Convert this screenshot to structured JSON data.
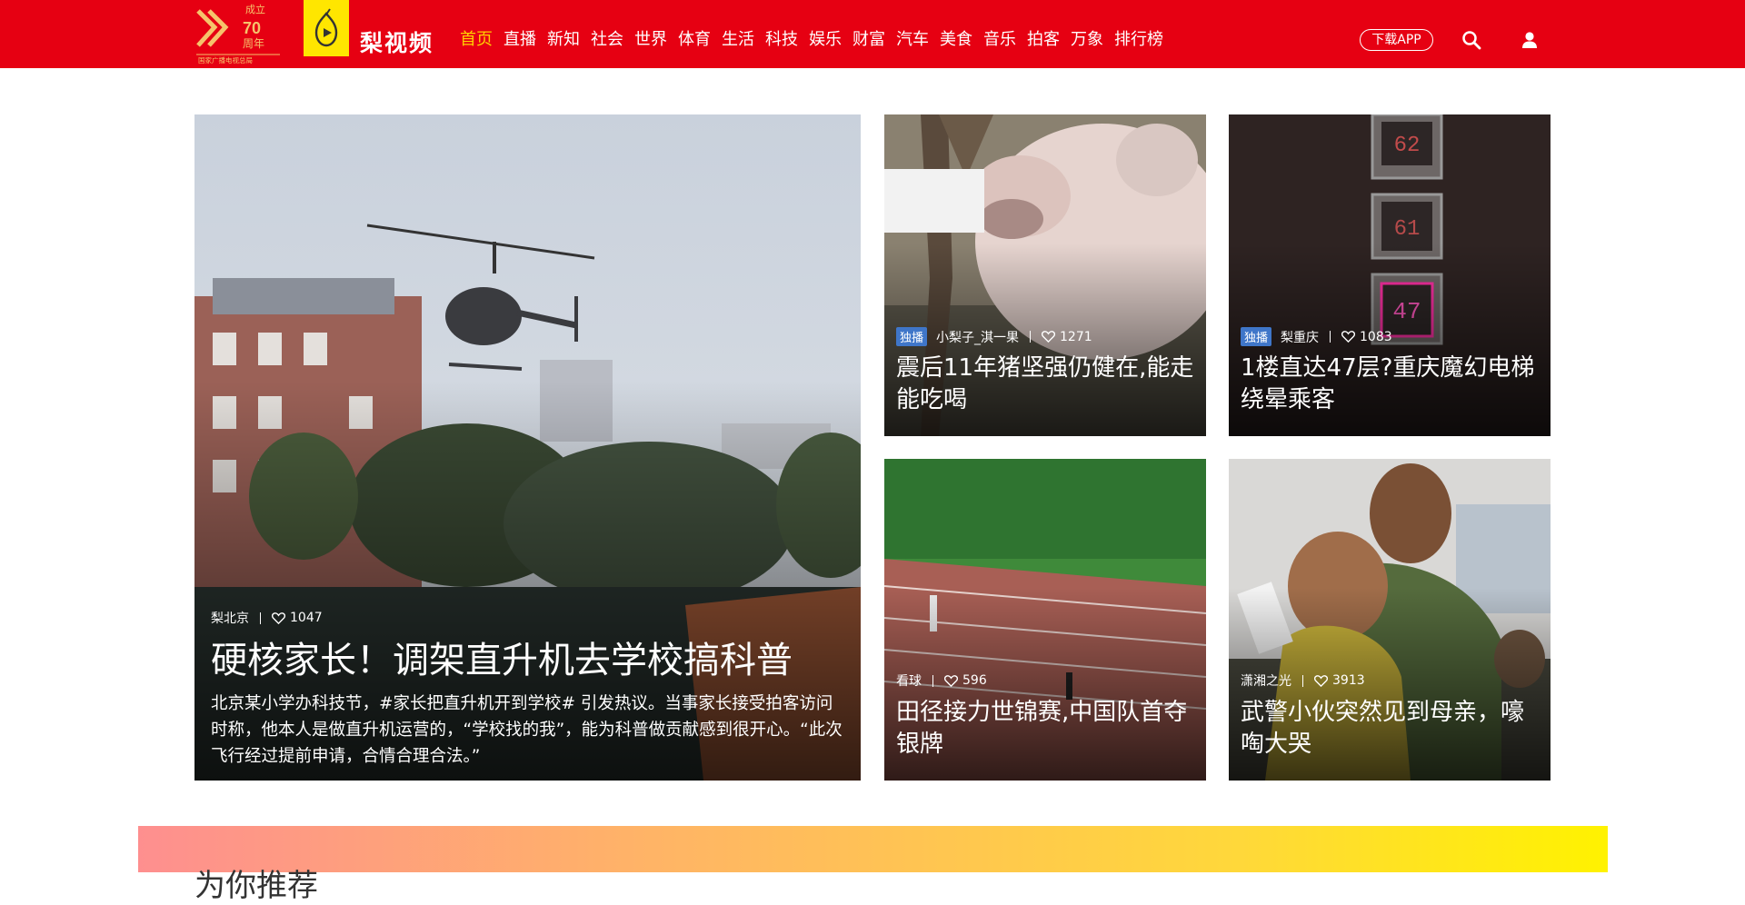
{
  "brand": {
    "name": "梨视频",
    "badge_number": "70",
    "badge_text": "周年",
    "badge_text_top": "成立",
    "badge_sub": "国家广播电视总局"
  },
  "nav": {
    "items": [
      {
        "label": "首页",
        "active": true
      },
      {
        "label": "直播",
        "active": false
      },
      {
        "label": "新知",
        "active": false
      },
      {
        "label": "社会",
        "active": false
      },
      {
        "label": "世界",
        "active": false
      },
      {
        "label": "体育",
        "active": false
      },
      {
        "label": "生活",
        "active": false
      },
      {
        "label": "科技",
        "active": false
      },
      {
        "label": "娱乐",
        "active": false
      },
      {
        "label": "财富",
        "active": false
      },
      {
        "label": "汽车",
        "active": false
      },
      {
        "label": "美食",
        "active": false
      },
      {
        "label": "音乐",
        "active": false
      },
      {
        "label": "拍客",
        "active": false
      },
      {
        "label": "万象",
        "active": false
      },
      {
        "label": "排行榜",
        "active": false
      }
    ],
    "download_label": "下载APP",
    "search_icon": "search-icon",
    "user_icon": "user-icon"
  },
  "main_card": {
    "source": "梨北京",
    "likes": "1047",
    "title": "硬核家长！调架直升机去学校搞科普",
    "description": "北京某小学办科技节，#家长把直升机开到学校# 引发热议。当事家长接受拍客访问时称，他本人是做直升机运营的，“学校找的我”，能为科普做贡献感到很开心。“此次飞行经过提前申请，合情合理合法。”"
  },
  "cards": [
    {
      "tag": "独播",
      "source": "小梨子_淇一果",
      "likes": "1271",
      "title": "震后11年猪坚强仍健在,能走能吃喝"
    },
    {
      "tag": "独播",
      "source": "梨重庆",
      "likes": "1083",
      "title": "1楼直达47层?重庆魔幻电梯绕晕乘客",
      "elevator_numbers": [
        "62",
        "61",
        "47"
      ]
    },
    {
      "tag": "",
      "source": "看球",
      "likes": "596",
      "title": "田径接力世锦赛,中国队首夺银牌"
    },
    {
      "tag": "",
      "source": "潇湘之光",
      "likes": "3913",
      "title": "武警小伙突然见到母亲，嚎啕大哭"
    }
  ],
  "recommend": {
    "title": "为你推荐"
  },
  "colors": {
    "header_bg": "#e60012",
    "nav_active": "#ffd100",
    "tag_bg": "#3f76c9",
    "pear_yellow": "#ffe600"
  }
}
